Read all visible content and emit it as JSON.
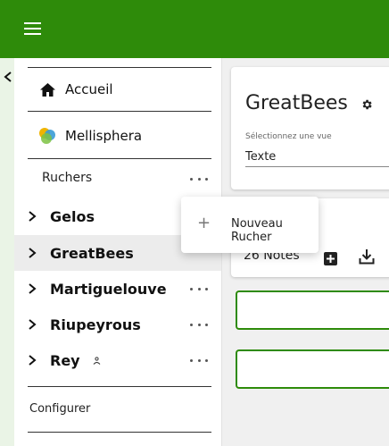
{
  "topbar": {
    "menu_icon": "hamburger-icon",
    "background": "#2e8b0a"
  },
  "sidebar": {
    "collapse_icon": "chevron-left-icon",
    "nav": [
      {
        "label": "Accueil",
        "icon": "home-icon"
      },
      {
        "label": "Mellisphera",
        "icon": "mellisphera-logo-icon"
      }
    ],
    "section_label": "Ruchers",
    "apiaries": [
      {
        "name": "Gelos"
      },
      {
        "name": "GreatBees"
      },
      {
        "name": "Martiguelouve"
      },
      {
        "name": "Riupeyrous"
      },
      {
        "name": "Rey"
      }
    ],
    "configure_label": "Configurer"
  },
  "main": {
    "title": "GreatBees",
    "view_label": "Sélectionnez une vue",
    "view_value": "Texte",
    "notes_label": "26 Notes"
  },
  "context_menu": {
    "items": [
      {
        "label": "Nouveau Rucher",
        "icon": "plus-icon"
      }
    ]
  },
  "colors": {
    "accent": "#2e8b0a",
    "selected_row": "#ececec"
  }
}
